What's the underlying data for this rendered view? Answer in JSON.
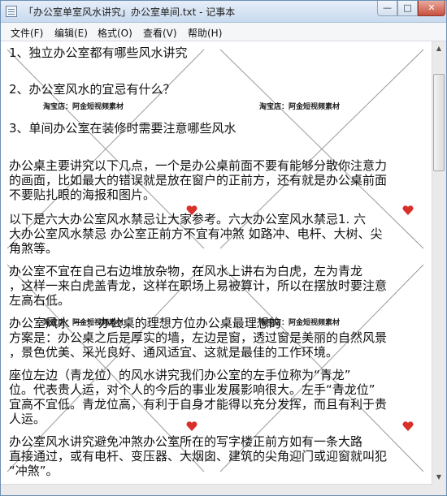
{
  "window": {
    "title": "「办公室单室风水讲究」办公室单间.txt - 记事本",
    "buttons": {
      "minimize": "—",
      "maximize": "□",
      "close": "✕"
    }
  },
  "menu": [
    "文件(F)",
    "编辑(E)",
    "格式(O)",
    "查看(V)",
    "帮助(H)"
  ],
  "document": {
    "lines": [
      "    1、独立办公室都有哪些风水讲究",
      "2、办公室风水的宜忌有什么？",
      "3、单间办公室在装修时需要注意哪些风水",
      "办公桌主要讲究以下几点，一个是办公桌前面不要有能够分散你注意力",
      "的画面，比如最大的错误就是放在窗户的正前方，还有就是办公桌前面",
      "不要贴扎眼的海报和图片。",
      "    以下是六大办公室风水禁忌让大家参考。六大办公室风水禁忌1. 六",
      "大办公室风水禁忌 办公室正前方不宜有冲煞 如路冲、电杆、大树、尖",
      "角煞等。",
      "    办公室不宜在自己右边堆放杂物，在风水上讲右为白虎，左为青龙",
      "，这样一来白虎盖青龙，这样在职场上易被算计，所以在摆放时要注意",
      "左高右低。",
      "    办公室风水 一：办公桌的理想方位办公桌最理想的",
      "方案是：办公桌之后是厚实的墙，左边是窗，透过窗是美丽的自然风景",
      "，景色优美、采光良好、通风适宜、这就是最佳的工作环境。",
      "    座位左边（青龙位）的风水讲究我们办公室的左手位称为“青龙”",
      "位。代表贵人运，对个人的今后的事业发展影响很大。左手“青龙位”",
      "宜高不宜低。青龙位高，有利于自身才能得以充分发挥，而且有利于贵",
      "人运。",
      "    办公室风水讲究避免冲煞办公室所在的写字楼正前方如有一条大路",
      "直接通过，或有电杆、变压器、大烟囱、建筑的尖角迎门或迎窗就叫犯",
      "“冲煞”。"
    ],
    "watermark": "淘宝店：阿金短视频素材"
  },
  "scrollbar": {
    "up": "▲",
    "down": "▼"
  },
  "colors": {
    "heart": "#d9302a",
    "watermark_line": "#9a9a9a"
  }
}
